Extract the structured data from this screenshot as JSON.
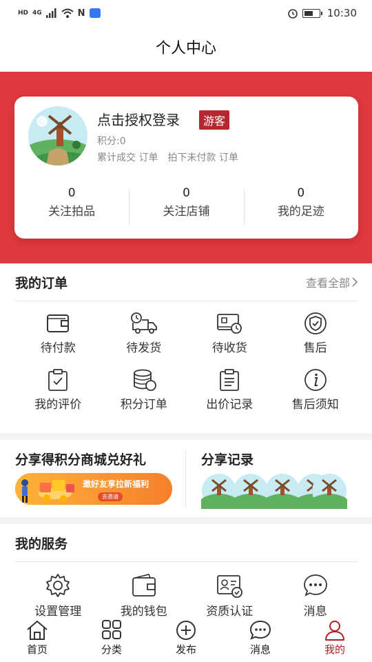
{
  "status_bar": {
    "time": "10:30",
    "hd": "HD",
    "network": "4G",
    "nfc": "N"
  },
  "header": {
    "title": "个人中心"
  },
  "profile": {
    "login_text": "点击授权登录",
    "badge": "游客",
    "points": "积分:0",
    "completed_orders": "累计成交 订单",
    "unpaid_orders": "拍下未付款 订单",
    "stats": [
      {
        "value": "0",
        "label": "关注拍品"
      },
      {
        "value": "0",
        "label": "关注店铺"
      },
      {
        "value": "0",
        "label": "我的足迹"
      }
    ]
  },
  "orders": {
    "title": "我的订单",
    "view_all": "查看全部",
    "items": [
      {
        "label": "待付款",
        "icon": "wallet-icon"
      },
      {
        "label": "待发货",
        "icon": "truck-icon"
      },
      {
        "label": "待收货",
        "icon": "receive-icon"
      },
      {
        "label": "售后",
        "icon": "shield-icon"
      },
      {
        "label": "我的评价",
        "icon": "clipboard-check-icon"
      },
      {
        "label": "积分订单",
        "icon": "coins-icon"
      },
      {
        "label": "出价记录",
        "icon": "clipboard-list-icon"
      },
      {
        "label": "售后须知",
        "icon": "info-icon"
      }
    ]
  },
  "share": {
    "title": "分享得积分商城兑好礼",
    "banner_text": "邀好友享拉新福利",
    "banner_button": "去邀请",
    "records_title": "分享记录"
  },
  "services": {
    "title": "我的服务",
    "items": [
      {
        "label": "设置管理",
        "icon": "gear-icon"
      },
      {
        "label": "我的钱包",
        "icon": "wallet-icon"
      },
      {
        "label": "资质认证",
        "icon": "certificate-icon"
      },
      {
        "label": "消息",
        "icon": "chat-icon"
      }
    ]
  },
  "tabbar": {
    "items": [
      {
        "label": "首页",
        "icon": "home-icon"
      },
      {
        "label": "分类",
        "icon": "grid-icon"
      },
      {
        "label": "发布",
        "icon": "plus-circle-icon"
      },
      {
        "label": "消息",
        "icon": "chat-icon"
      },
      {
        "label": "我的",
        "icon": "user-icon",
        "active": true
      }
    ]
  },
  "colors": {
    "brand_red": "#e0383e",
    "active_tab": "#b01f24",
    "badge": "#b5282f"
  }
}
